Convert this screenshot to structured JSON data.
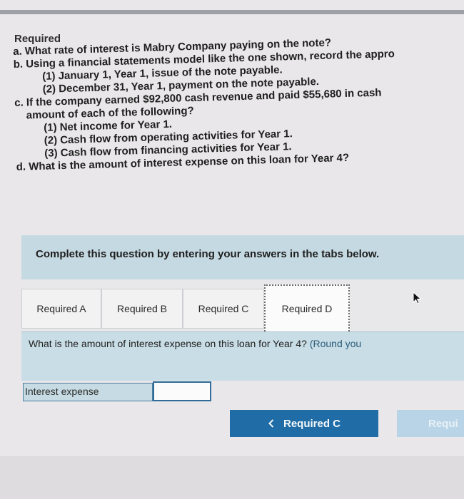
{
  "required_heading": "Required",
  "questions": {
    "a": "a. What rate of interest is Mabry Company paying on the note?",
    "b": "b. Using a financial statements model like the one shown, record the appro",
    "b1": "(1) January 1, Year 1, issue of the note payable.",
    "b2": "(2) December 31, Year 1, payment on the note payable.",
    "c": "c. If the company earned $92,800 cash revenue and paid $55,680 in cash",
    "c_cont": "amount of each of the following?",
    "c1": "(1) Net income for Year 1.",
    "c2": "(2) Cash flow from operating activities for Year 1.",
    "c3": "(3) Cash flow from financing activities for Year 1.",
    "d": "d. What is the amount of interest expense on this loan for Year 4?"
  },
  "instruction": "Complete this question by entering your answers in the tabs below.",
  "tabs": [
    {
      "label": "Required A"
    },
    {
      "label": "Required B"
    },
    {
      "label": "Required C"
    },
    {
      "label": "Required D"
    }
  ],
  "active_tab": "Required D",
  "question_prompt": "What is the amount of interest expense on this loan for Year 4?",
  "round_note": "(Round you",
  "answer": {
    "label": "Interest expense",
    "value": ""
  },
  "nav": {
    "prev_label": "Required C",
    "prev_icon": "chevron-left-icon",
    "next_label": "Requi"
  },
  "colors": {
    "accent": "#1f6ca6",
    "panel": "#c8dde6",
    "disabled_button": "#b9d4e6"
  }
}
